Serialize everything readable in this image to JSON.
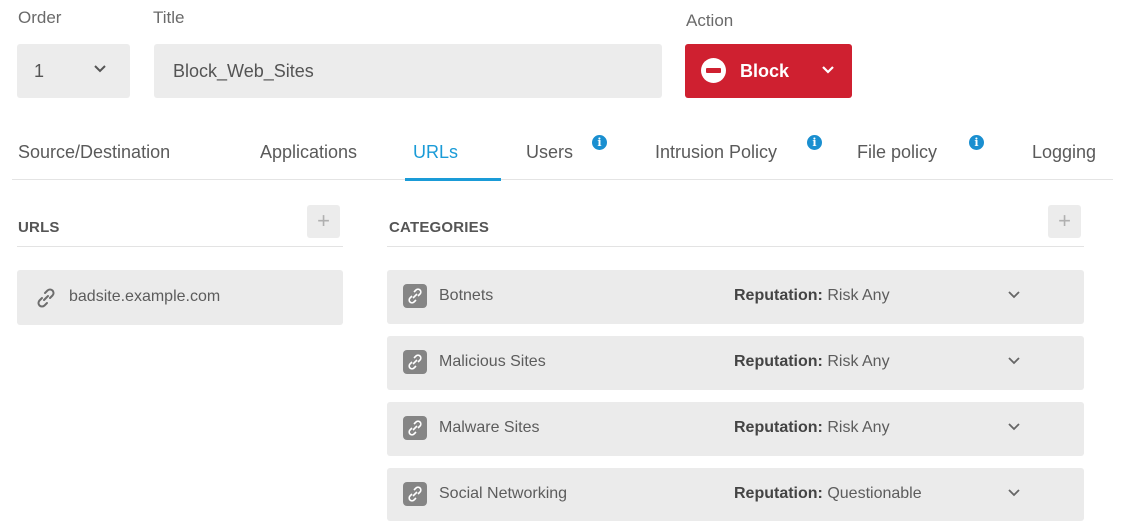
{
  "header": {
    "order_label": "Order",
    "title_label": "Title",
    "action_label": "Action",
    "order_value": "1",
    "title_value": "Block_Web_Sites",
    "action_value": "Block",
    "action_color": "#cf2030"
  },
  "tabs": [
    {
      "label": "Source/Destination",
      "active": false,
      "info": false
    },
    {
      "label": "Applications",
      "active": false,
      "info": false
    },
    {
      "label": "URLs",
      "active": true,
      "info": false
    },
    {
      "label": "Users",
      "active": false,
      "info": true
    },
    {
      "label": "Intrusion Policy",
      "active": false,
      "info": true
    },
    {
      "label": "File policy",
      "active": false,
      "info": true
    },
    {
      "label": "Logging",
      "active": false,
      "info": false
    }
  ],
  "info_badge": "i",
  "accent_color": "#1a9bd7",
  "urls": {
    "title": "URLS",
    "add_label": "+",
    "items": [
      "badsite.example.com"
    ]
  },
  "categories": {
    "title": "CATEGORIES",
    "add_label": "+",
    "reputation_label": "Reputation:",
    "items": [
      {
        "name": "Botnets",
        "reputation": "Risk Any"
      },
      {
        "name": "Malicious Sites",
        "reputation": "Risk Any"
      },
      {
        "name": "Malware Sites",
        "reputation": "Risk Any"
      },
      {
        "name": "Social Networking",
        "reputation": "Questionable"
      }
    ]
  },
  "icons": {
    "order_chevron": "chevron-down-icon",
    "action_icon": "minus-circle-icon",
    "url_icon": "link-icon",
    "category_icon": "link-box-icon"
  }
}
